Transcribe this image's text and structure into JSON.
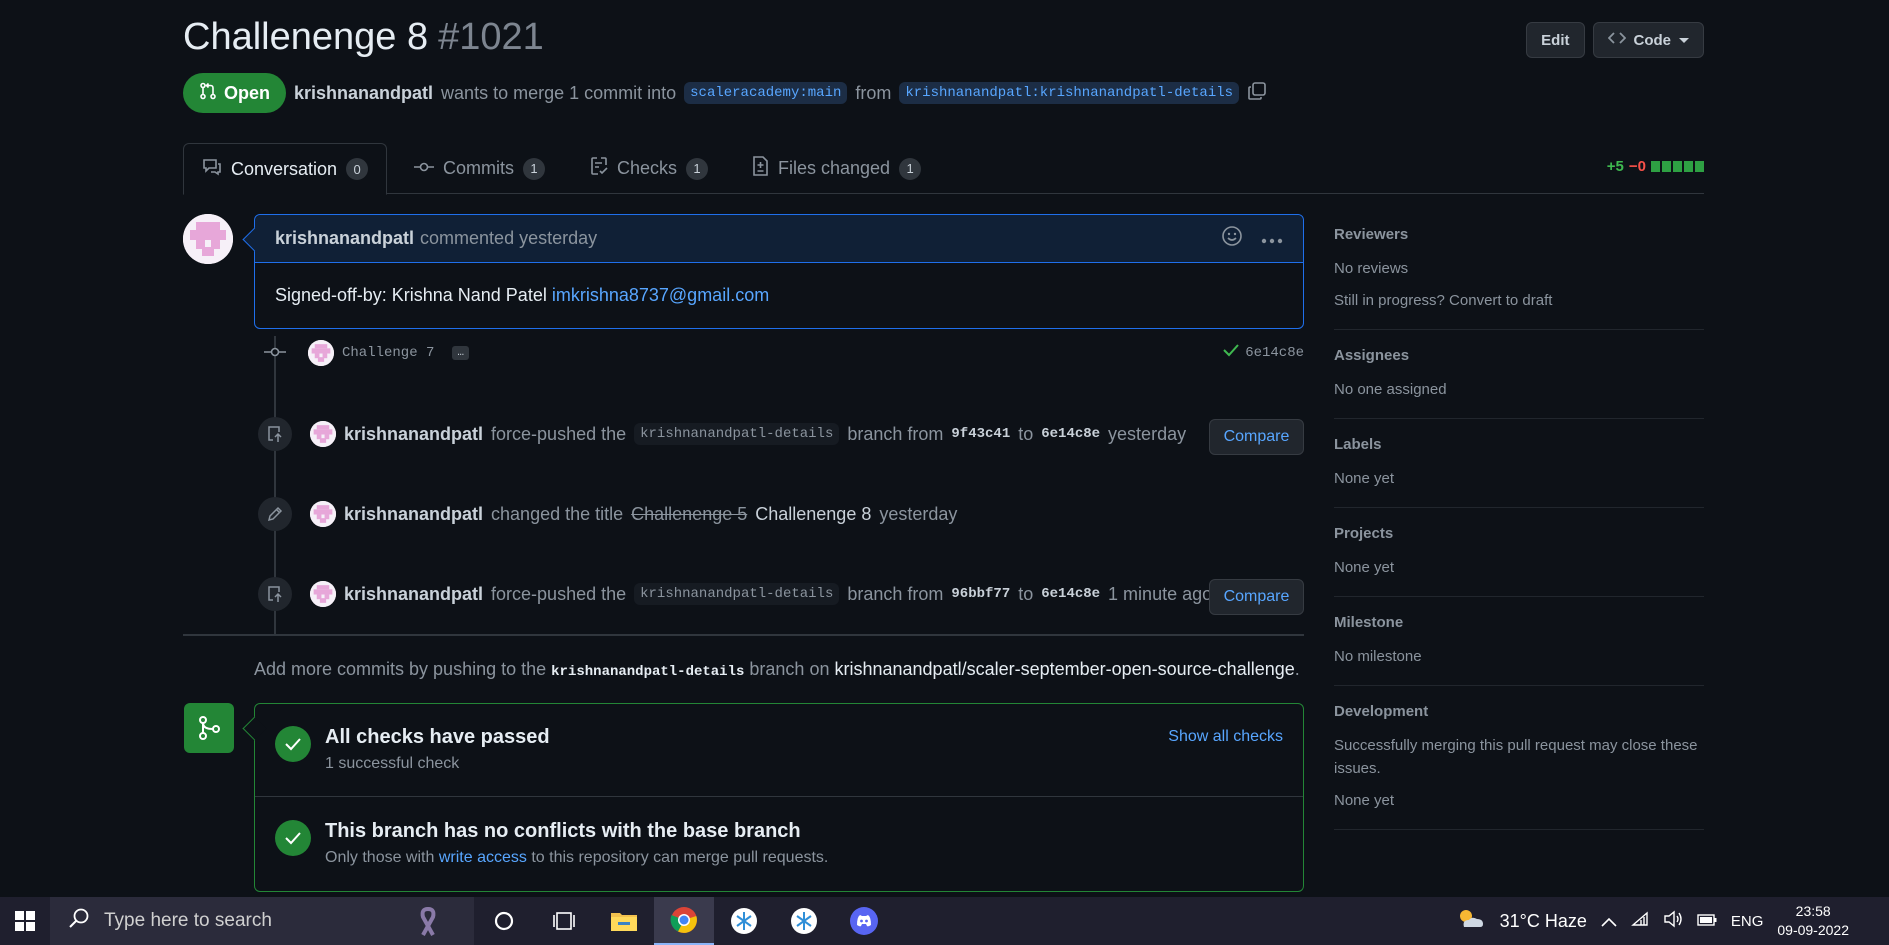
{
  "header": {
    "title": "Challenenge 8",
    "number": "#1021",
    "edit_label": "Edit",
    "code_label": "Code"
  },
  "meta": {
    "state": "Open",
    "author": "krishnanandpatl",
    "text1": "wants to merge 1 commit into",
    "base_branch": "scaleracademy:main",
    "text2": "from",
    "head_branch": "krishnanandpatl:krishnanandpatl-details"
  },
  "tabs": [
    {
      "label": "Conversation",
      "count": "0"
    },
    {
      "label": "Commits",
      "count": "1"
    },
    {
      "label": "Checks",
      "count": "1"
    },
    {
      "label": "Files changed",
      "count": "1"
    }
  ],
  "diffstat": {
    "additions": "+5",
    "deletions": "−0"
  },
  "comment": {
    "author": "krishnanandpatl",
    "action": "commented yesterday",
    "body_text": "Signed-off-by: Krishna Nand Patel",
    "body_link": "imkrishna8737@gmail.com"
  },
  "commit": {
    "message": "Challenge 7",
    "ellipsis": "…",
    "sha": "6e14c8e"
  },
  "events": [
    {
      "actor": "krishnanandpatl",
      "text1": "force-pushed the",
      "branch": "krishnanandpatl-details",
      "text2": "branch from",
      "from_sha": "9f43c41",
      "to": "to",
      "to_sha": "6e14c8e",
      "time": "yesterday",
      "button": "Compare"
    },
    {
      "actor": "krishnanandpatl",
      "text1": "changed the title",
      "old_title": "Challenenge 5",
      "new_title": "Challenenge 8",
      "time": "yesterday"
    },
    {
      "actor": "krishnanandpatl",
      "text1": "force-pushed the",
      "branch": "krishnanandpatl-details",
      "text2": "branch from",
      "from_sha": "96bbf77",
      "to": "to",
      "to_sha": "6e14c8e",
      "time": "1 minute ago",
      "button": "Compare"
    }
  ],
  "hint": {
    "text1": "Add more commits by pushing to the",
    "branch": "krishnanandpatl-details",
    "text2": "branch on",
    "repo": "krishnanandpatl/scaler-september-open-source-challenge",
    "end": "."
  },
  "merge": {
    "checks_title": "All checks have passed",
    "checks_sub": "1 successful check",
    "show_checks": "Show all checks",
    "conflict_title": "This branch has no conflicts with the base branch",
    "conflict_sub1": "Only those with",
    "conflict_link": "write access",
    "conflict_sub2": "to this repository can merge pull requests."
  },
  "sidebar": {
    "reviewers": {
      "title": "Reviewers",
      "value": "No reviews",
      "extra": "Still in progress? Convert to draft"
    },
    "assignees": {
      "title": "Assignees",
      "value": "No one assigned"
    },
    "labels": {
      "title": "Labels",
      "value": "None yet"
    },
    "projects": {
      "title": "Projects",
      "value": "None yet"
    },
    "milestone": {
      "title": "Milestone",
      "value": "No milestone"
    },
    "development": {
      "title": "Development",
      "desc": "Successfully merging this pull request may close these issues.",
      "value": "None yet"
    }
  },
  "taskbar": {
    "search_placeholder": "Type here to search",
    "weather": "31°C  Haze",
    "lang": "ENG",
    "time": "23:58",
    "date": "09-09-2022"
  },
  "colors": {
    "accent": "#58a6ff",
    "success": "#238636",
    "danger": "#f85149",
    "bg": "#0d1117"
  }
}
